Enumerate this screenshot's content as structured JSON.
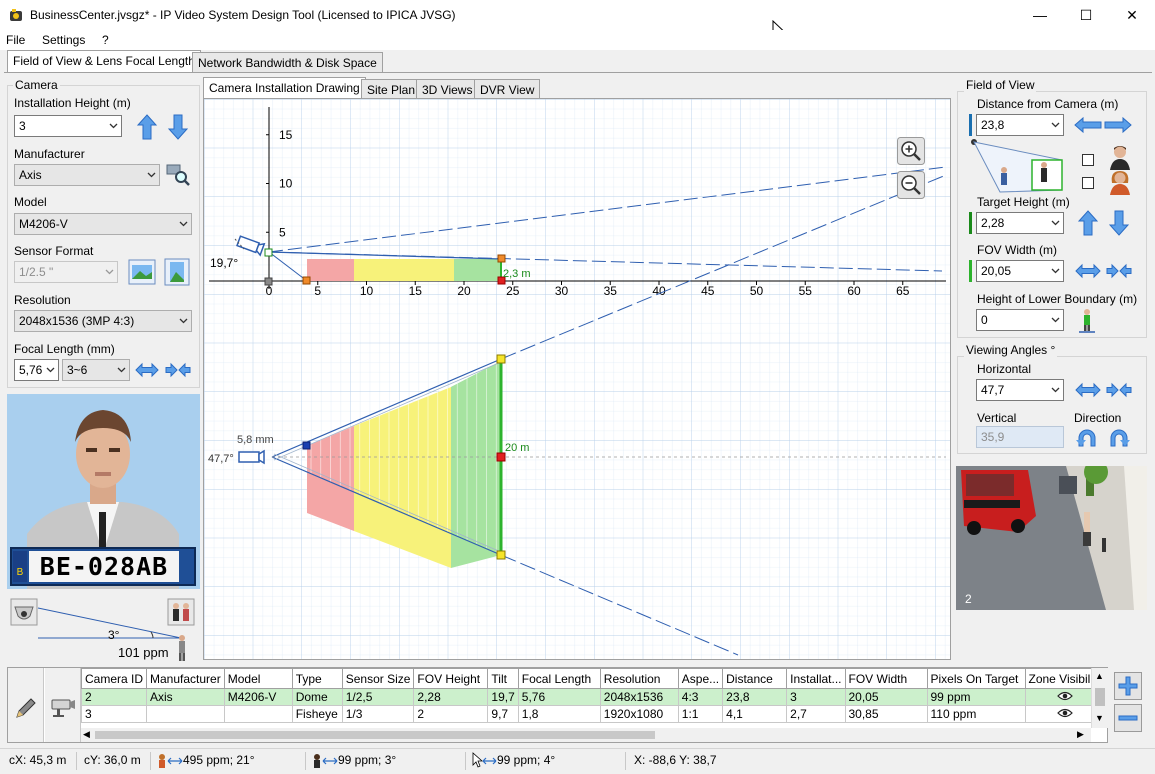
{
  "window": {
    "title": "BusinessCenter.jvsgz* - IP Video System Design Tool (Licensed to IPICA JVSG)"
  },
  "menu": [
    "File",
    "Settings",
    "?"
  ],
  "main_tabs": [
    "Field of View & Lens Focal Length",
    "Network Bandwidth & Disk Space"
  ],
  "view_tabs": [
    "Camera Installation Drawing",
    "Site Plan",
    "3D Views",
    "DVR View"
  ],
  "camera": {
    "group": "Camera",
    "height_label": "Installation Height (m)",
    "height_value": "3",
    "manufacturer_label": "Manufacturer",
    "manufacturer_value": "Axis",
    "model_label": "Model",
    "model_value": "M4206-V",
    "sensor_label": "Sensor Format",
    "sensor_value": "1/2.5 \"",
    "resolution_label": "Resolution",
    "resolution_value": "2048x1536 (3MP 4:3)",
    "focal_label": "Focal Length (mm)",
    "focal_value": "5,76",
    "focal_range": "3~6"
  },
  "preview": {
    "plate": "BE-028AB",
    "plate_code": "B",
    "angle": "3°",
    "ppm": "101 ppm"
  },
  "drawing": {
    "side_angle": "19,7°",
    "top_angle": "47,7°",
    "focal_mm": "5,8 mm",
    "side_height": "2,3 m",
    "top_width": "20 m",
    "y_ticks": [
      "15",
      "10",
      "5"
    ],
    "x_ticks": [
      "0",
      "5",
      "10",
      "15",
      "20",
      "25",
      "30",
      "35",
      "40",
      "45",
      "50",
      "55",
      "60",
      "65"
    ]
  },
  "fov": {
    "group": "Field of View",
    "distance_label": "Distance from Camera  (m)",
    "distance_value": "23,8",
    "target_label": "Target Height (m)",
    "target_value": "2,28",
    "width_label": "FOV Width (m)",
    "width_value": "20,05",
    "lower_label": "Height of Lower Boundary (m)",
    "lower_value": "0"
  },
  "angles": {
    "group": "Viewing Angles °",
    "horizontal_label": "Horizontal",
    "horizontal_value": "47,7",
    "vertical_label": "Vertical",
    "vertical_value": "35,9",
    "direction_label": "Direction"
  },
  "view3d": {
    "number": "2"
  },
  "table": {
    "headers": [
      "Camera ID",
      "Manufacturer",
      "Model",
      "Type",
      "Sensor Size",
      "FOV Height",
      "Tilt",
      "Focal Length",
      "Resolution",
      "Aspe...",
      "Distance",
      "Installat...",
      "FOV Width",
      "Pixels On Target",
      "Zone Visibility"
    ],
    "rows": [
      [
        "2",
        "Axis",
        "M4206-V",
        "Dome",
        "1/2,5",
        "2,28",
        "19,7",
        "5,76",
        "2048x1536",
        "4:3",
        "23,8",
        "3",
        "20,05",
        "99 ppm"
      ],
      [
        "3",
        "",
        "",
        "Fisheye",
        "1/3",
        "2",
        "9,7",
        "1,8",
        "1920x1080",
        "1:1",
        "4,1",
        "2,7",
        "30,85",
        "110 ppm"
      ]
    ]
  },
  "status": {
    "cx": "cX: 45,3 m",
    "cy": "cY: 36,0 m",
    "s1": "495 ppm; 21°",
    "s2": "99 ppm; 3°",
    "s3": "99 ppm; 4°",
    "coords": "X: -88,6 Y: 38,7"
  },
  "colors": {
    "red_zone": "#f4a6a6",
    "yellow_zone": "#f7f27a",
    "green_zone": "#a6e3a0",
    "fov_line": "#2f5fb0",
    "grid": "#c9ddf1",
    "selected_row": "#ccf0cc"
  }
}
